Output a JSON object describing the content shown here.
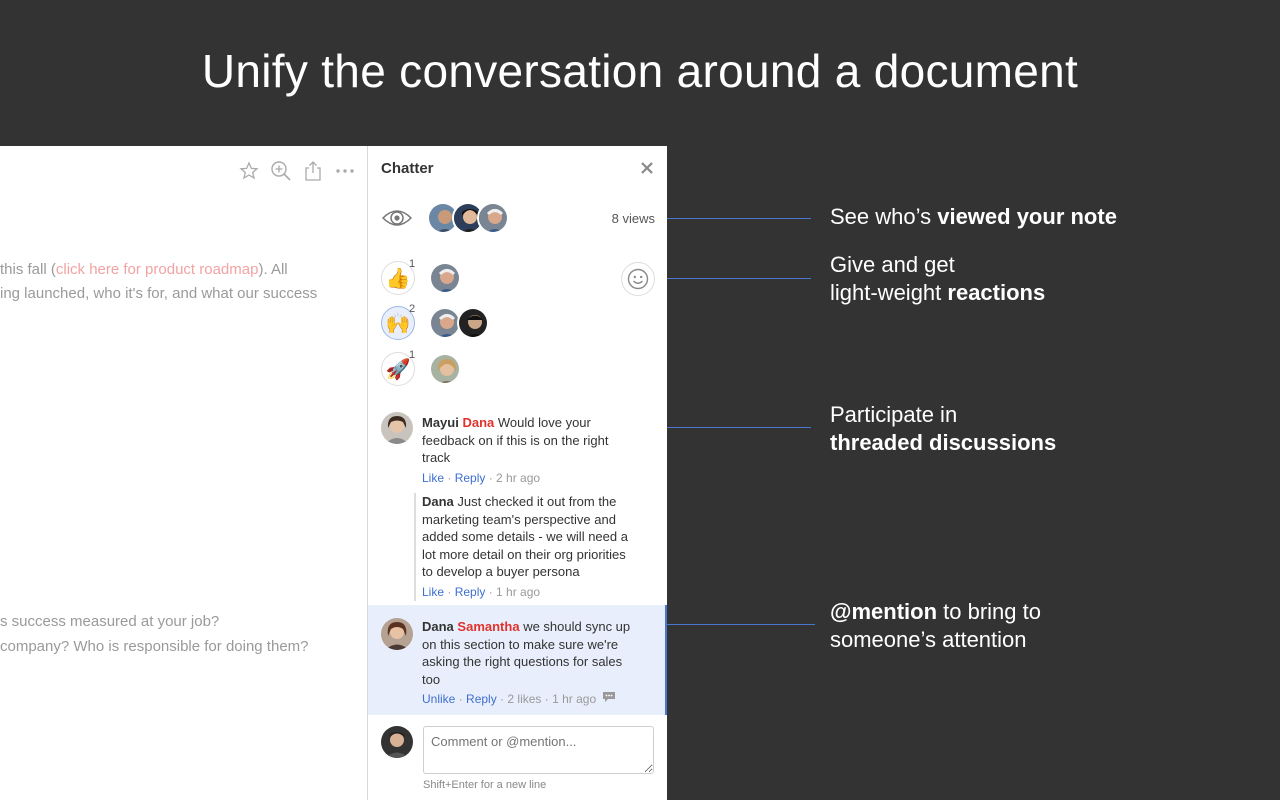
{
  "headline": "Unify the conversation around a document",
  "doc": {
    "para1_line1_pre": "this fall (",
    "para1_link": "click here for product roadmap",
    "para1_line1_post": "). All",
    "para1_line2": "ing launched, who it's for, and what our success",
    "para2_line1": "s success measured at your job?",
    "para2_line2": "company? Who is responsible for doing them?"
  },
  "chatter": {
    "title": "Chatter",
    "views": "8 views",
    "reactions": [
      {
        "emoji": "👍",
        "count": "1"
      },
      {
        "emoji": "🙌",
        "count": "2"
      },
      {
        "emoji": "🚀",
        "count": "1"
      }
    ],
    "comment1": {
      "author": "Mayui",
      "mention": "Dana",
      "text_line1": "Would love your",
      "text_line2": "feedback on if this is on the right",
      "text_line3": "track",
      "like": "Like",
      "reply": "Reply",
      "time": "2 hr ago"
    },
    "reply1": {
      "author": "Dana",
      "line1": "Just checked it out from the",
      "line2": "marketing team's perspective and",
      "line3": "added some details - we will need a",
      "line4": "lot more detail on their org priorities",
      "line5": "to develop a buyer persona",
      "like": "Like",
      "reply": "Reply",
      "time": "1 hr ago"
    },
    "comment2": {
      "author": "Dana",
      "mention": "Samantha",
      "line1": "we should sync up",
      "line2": "on this section to make sure we're",
      "line3": "asking the right questions for sales",
      "line4": "too",
      "unlike": "Unlike",
      "reply": "Reply",
      "likes": "2 likes",
      "time": "1 hr ago"
    },
    "input_placeholder": "Comment or @mention...",
    "input_hint": "Shift+Enter for a new line"
  },
  "callouts": {
    "c1_pre": "See who’s ",
    "c1_bold": "viewed your note",
    "c2_line1": "Give and get",
    "c2_pre": "light-weight ",
    "c2_bold": "reactions",
    "c3_line1": "Participate in",
    "c3_bold": "threaded discussions",
    "c4_bold": "@mention",
    "c4_post": " to bring to",
    "c4_line2": "someone’s attention"
  },
  "colors": {
    "background": "#333333",
    "accent_blue": "#4a78d0",
    "mention_red": "#e0322c",
    "link_pink": "#f2a3a3"
  }
}
